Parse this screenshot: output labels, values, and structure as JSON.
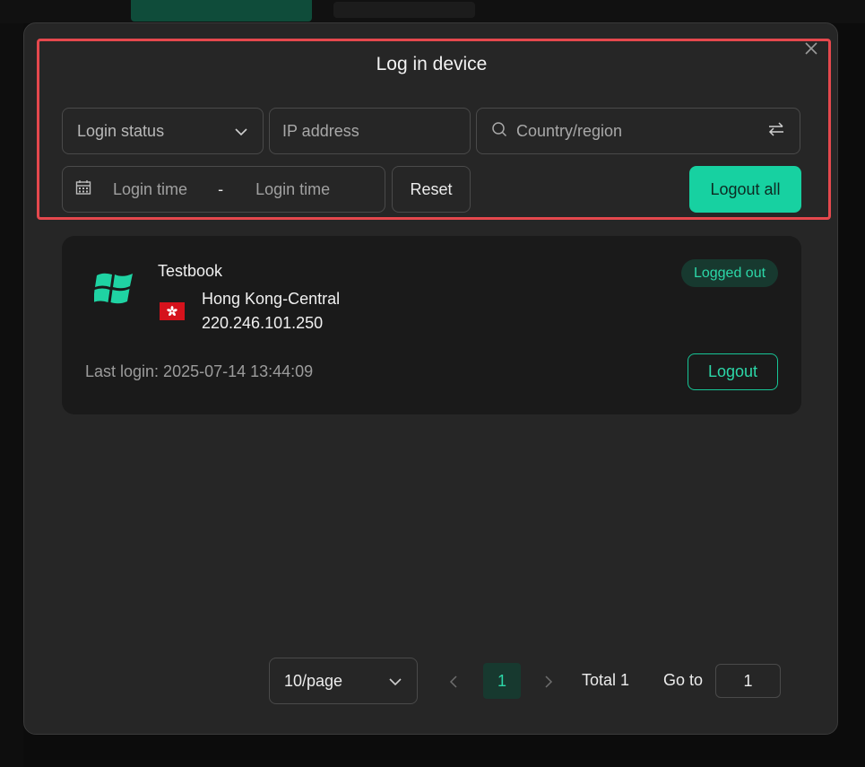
{
  "modal": {
    "title": "Log in device"
  },
  "filters": {
    "login_status_placeholder": "Login status",
    "ip_placeholder": "IP address",
    "country_placeholder": "Country/region",
    "login_time_start": "Login time",
    "date_separator": "-",
    "login_time_end": "Login time",
    "reset_label": "Reset",
    "logout_all_label": "Logout all"
  },
  "device": {
    "name": "Testbook",
    "location": "Hong Kong-Central",
    "ip": "220.246.101.250",
    "last_login": "Last login: 2025-07-14 13:44:09",
    "status": "Logged out",
    "logout_label": "Logout",
    "os_icon": "windows-icon",
    "flag_icon": "hong-kong-flag-icon"
  },
  "pagination": {
    "page_size": "10/page",
    "current_page": "1",
    "total": "Total 1",
    "goto_label": "Go to",
    "goto_value": "1"
  },
  "colors": {
    "accent": "#17d1a1",
    "badge_bg": "#17392f",
    "highlight": "#e5484d",
    "card_bg": "#1a1a1a",
    "modal_bg": "#262626"
  }
}
